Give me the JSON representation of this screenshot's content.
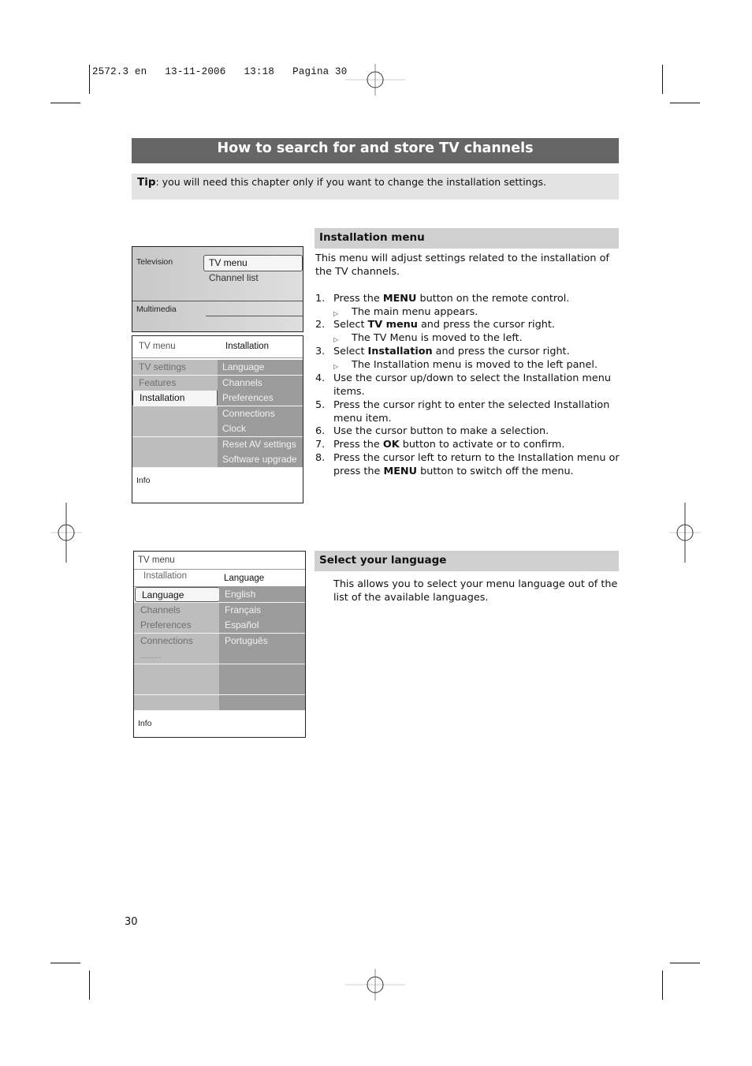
{
  "print_slug": "2572.3 en   13-11-2006   13:18   Pagina 30",
  "page_title": "How to search for and store TV channels",
  "tip": {
    "label": "Tip",
    "text": ": you will need this chapter only if you want to change the installation settings."
  },
  "screen1": {
    "left_top": "Television",
    "left_bottom": "Multimedia",
    "selected": "TV menu",
    "item2": "Channel list"
  },
  "screen2": {
    "header_left": "TV menu",
    "header_right": "Installation",
    "left_items": [
      "TV settings",
      "Features",
      "Installation"
    ],
    "right_items": [
      "Language",
      "Channels",
      "Preferences",
      "Connections",
      "Clock",
      "Reset AV settings",
      "Software upgrade"
    ],
    "info": "Info"
  },
  "screen3": {
    "header": "TV menu",
    "sub_left": "Installation",
    "sub_right": "Language",
    "left_items": [
      "Language",
      "Channels",
      "Preferences",
      "Connections",
      "............"
    ],
    "right_items": [
      "English",
      "Français",
      "Español",
      "Português"
    ],
    "info": "Info"
  },
  "installation": {
    "heading": "Installation menu",
    "intro": "This menu will adjust settings related to the installation of the TV channels.",
    "steps": [
      {
        "num": "1.",
        "pre": "Press the ",
        "bold": "MENU",
        "post": " button on the remote control.",
        "sub": "The main menu appears."
      },
      {
        "num": "2.",
        "pre": "Select ",
        "bold": "TV menu",
        "post": " and press the cursor right.",
        "sub": "The TV Menu is moved to the left."
      },
      {
        "num": "3.",
        "pre": "Select ",
        "bold": "Installation",
        "post": " and press the cursor right.",
        "sub": "The Installation menu is moved to the left panel."
      },
      {
        "num": "4.",
        "text": "Use the cursor up/down to select the Installation menu items."
      },
      {
        "num": "5.",
        "text": "Press the cursor right to enter the selected Installation menu item."
      },
      {
        "num": "6.",
        "text": "Use the cursor button to make a selection."
      },
      {
        "num": "7.",
        "pre": "Press the ",
        "bold": "OK",
        "post": " button to activate or to confirm."
      },
      {
        "num": "8.",
        "pre": "Press the cursor left to return to the Installation menu or press the ",
        "bold": "MENU",
        "post": " button to switch off the menu."
      }
    ]
  },
  "language": {
    "heading": "Select your language",
    "text": "This allows you to select your menu language out of the list of the available languages."
  },
  "page_number": "30",
  "icons": {
    "registration_mark": "crosshair-circle"
  }
}
